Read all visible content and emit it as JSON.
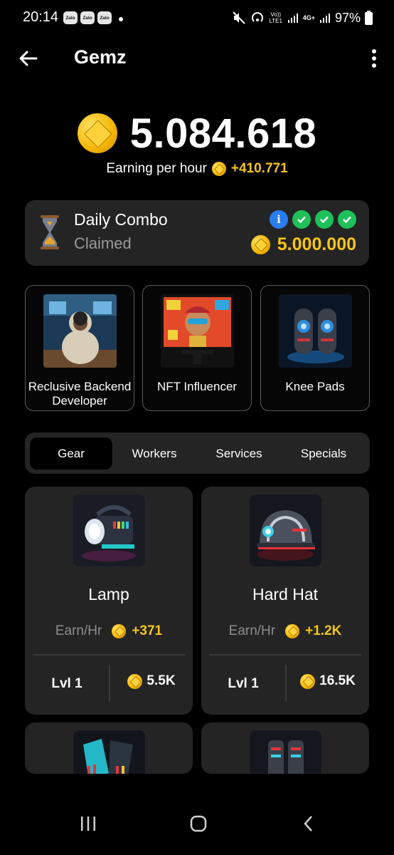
{
  "status_bar": {
    "time": "20:14",
    "notification_badges": [
      "Zalo",
      "Zalo",
      "Zalo"
    ],
    "network_label": "Vo)) LTE1",
    "network_type": "4G+",
    "battery": "97%"
  },
  "app_bar": {
    "title": "Gemz",
    "back_icon": "arrow-left-icon",
    "menu_icon": "more-vertical-icon"
  },
  "balance": {
    "value": "5.084.618",
    "earning_label": "Earning per hour",
    "earning_value": "+410.771"
  },
  "daily_combo": {
    "title": "Daily Combo",
    "status": "Claimed",
    "info_icon": "i",
    "checks": 3,
    "reward": "5.000.000"
  },
  "combo_cards": [
    {
      "label": "Reclusive Backend Developer"
    },
    {
      "label": "NFT Influencer"
    },
    {
      "label": "Knee Pads"
    }
  ],
  "tabs": [
    {
      "label": "Gear",
      "active": true
    },
    {
      "label": "Workers",
      "active": false
    },
    {
      "label": "Services",
      "active": false
    },
    {
      "label": "Specials",
      "active": false
    }
  ],
  "items": [
    {
      "name": "Lamp",
      "earn_label": "Earn/Hr",
      "earn": "+371",
      "level": "Lvl 1",
      "cost": "5.5K"
    },
    {
      "name": "Hard Hat",
      "earn_label": "Earn/Hr",
      "earn": "+1.2K",
      "level": "Lvl 1",
      "cost": "16.5K"
    }
  ],
  "colors": {
    "accent_gold": "#f5c518",
    "card_bg": "#242424",
    "info_blue": "#2b7cf0",
    "check_green": "#1ec05a"
  }
}
